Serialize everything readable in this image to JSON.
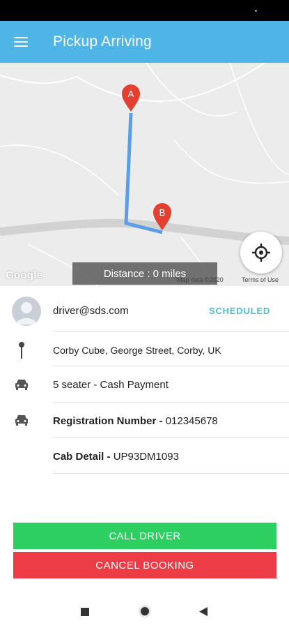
{
  "app_bar": {
    "title": "Pickup Arriving",
    "color": "#4fb5e6"
  },
  "map": {
    "marker_a": "A",
    "marker_b": "B",
    "distance": "Distance : 0 miles",
    "google_logo": "Google",
    "map_data": "Map data ©2020",
    "terms": "Terms of Use",
    "route_color": "#5b9ee8",
    "marker_color": "#e44032"
  },
  "driver": {
    "email": "driver@sds.com",
    "status": "SCHEDULED"
  },
  "details": {
    "address": "Corby Cube, George Street, Corby, UK",
    "seats_payment": "5 seater - Cash Payment",
    "registration_label": "Registration Number -",
    "registration_value": "012345678",
    "cab_label": "Cab Detail -",
    "cab_value": "UP93DM1093"
  },
  "actions": {
    "call_driver": "CALL DRIVER",
    "cancel_booking": "CANCEL BOOKING",
    "call_color": "#2dd060",
    "cancel_color": "#ec3c45"
  },
  "icons": {
    "menu": "hamburger-menu-icon",
    "locate": "crosshair-locate-icon",
    "pin": "pin-icon",
    "car": "car-icon",
    "nav_recent": "square-recents-icon",
    "nav_home": "circle-home-icon",
    "nav_back": "triangle-back-icon"
  }
}
